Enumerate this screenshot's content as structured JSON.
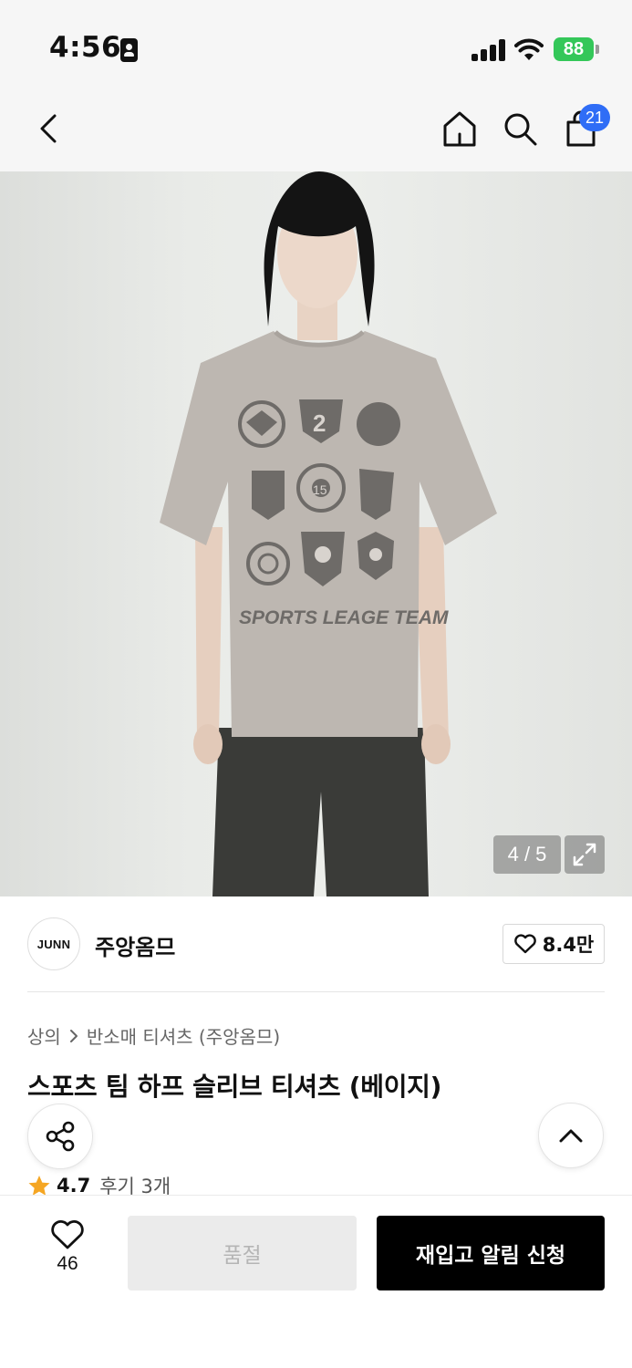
{
  "status_bar": {
    "time": "4:56",
    "battery": "88"
  },
  "nav": {
    "back_icon": "chevron-left-icon",
    "home_icon": "home-icon",
    "search_icon": "search-icon",
    "cart_icon": "shopping-bag-icon",
    "cart_count": "21"
  },
  "product_image": {
    "counter": "4 / 5",
    "shirt_print_text": "SPORTS LEAGE TEAM",
    "expand_icon": "expand-icon"
  },
  "brand": {
    "logo_text": "JUNN",
    "name": "주앙옴므",
    "like_count": "8.4만"
  },
  "breadcrumb": {
    "category": "상의",
    "subcategory": "반소매 티셔츠 (주앙옴므)"
  },
  "product": {
    "title": "스포츠 팀 하프 슬리브 티셔츠 (베이지)",
    "rating": "4.7",
    "review_label": "후기 3개"
  },
  "floating": {
    "share_icon": "share-icon",
    "top_icon": "chevron-up-icon"
  },
  "bottom_bar": {
    "wish_count": "46",
    "soldout_label": "품절",
    "restock_label": "재입고 알림 신청"
  },
  "colors": {
    "accent": "#2f6df6",
    "battery": "#34c759",
    "star": "#f5a623",
    "cta": "#000000"
  }
}
